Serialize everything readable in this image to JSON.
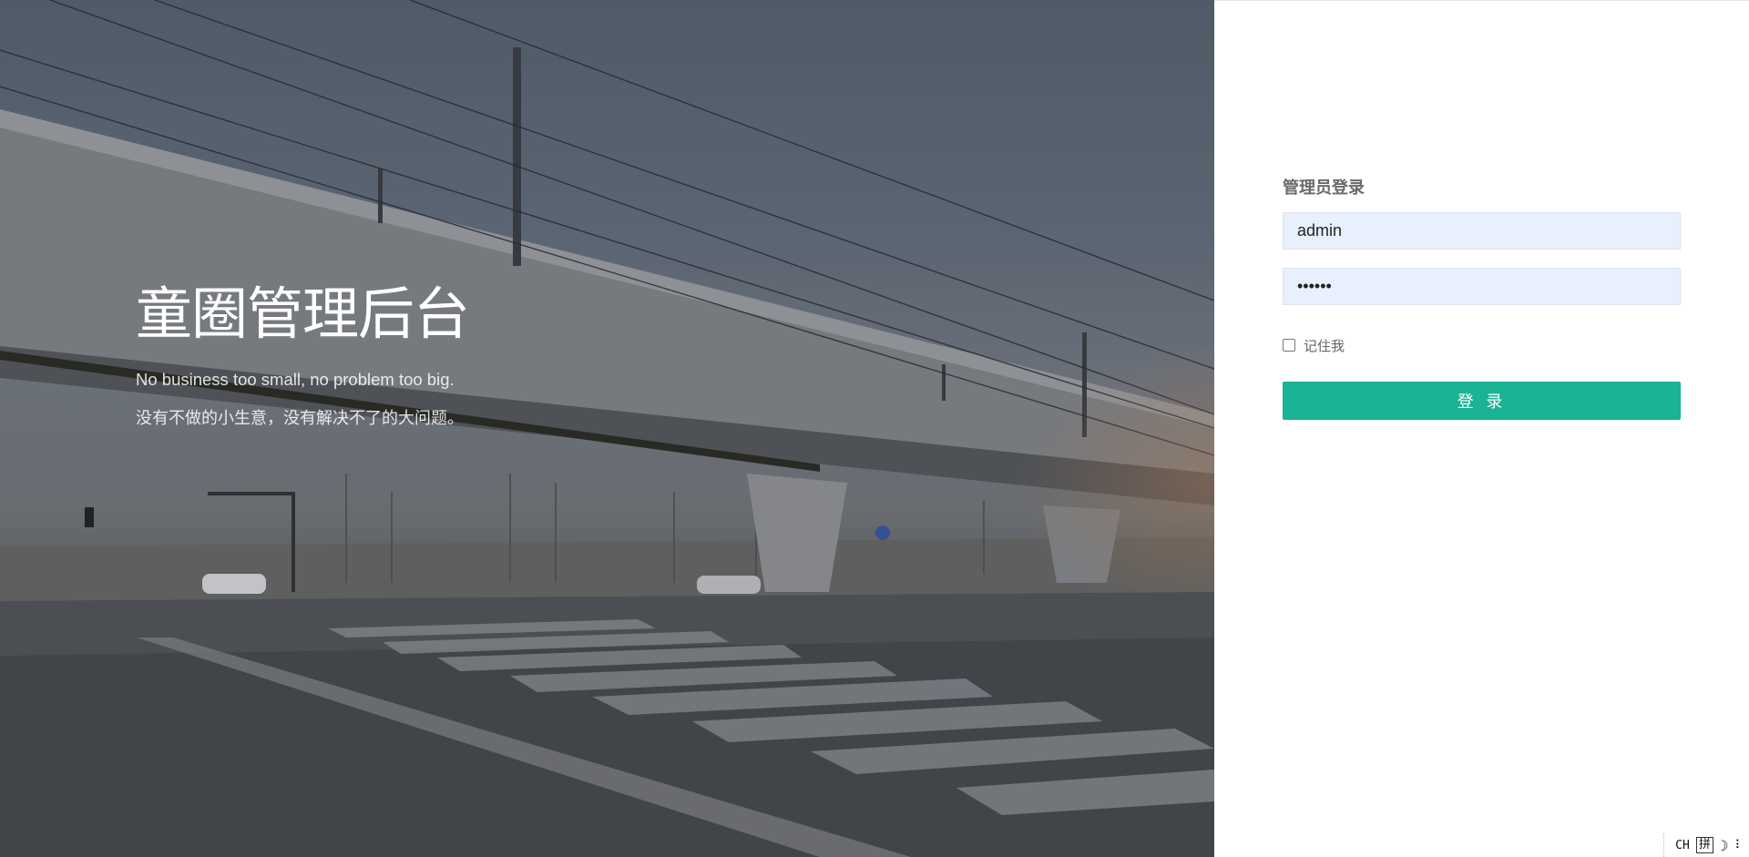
{
  "hero": {
    "title": "童圈管理后台",
    "subtitle_en": "No business too small, no problem too big.",
    "subtitle_cn": "没有不做的小生意，没有解决不了的大问题。"
  },
  "login": {
    "heading": "管理员登录",
    "username_value": "admin",
    "password_value": "••••••",
    "remember_label": "记住我",
    "remember_checked": false,
    "submit_label": "登 录"
  },
  "ime": {
    "mode": "CH",
    "layout": "拼",
    "moon_icon": "☽",
    "more_icon": "⠇"
  },
  "colors": {
    "accent": "#1ab394",
    "input_bg": "#e8f0fe",
    "heading": "#6a6a6a"
  }
}
